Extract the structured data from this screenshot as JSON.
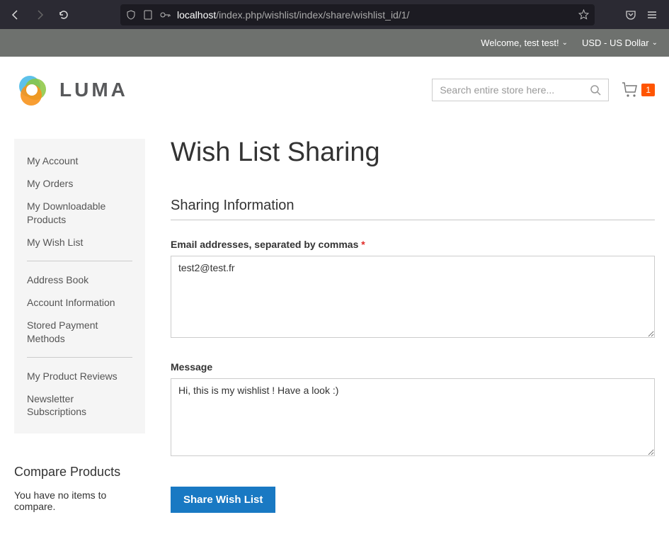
{
  "browser": {
    "url_host": "localhost",
    "url_path": "/index.php/wishlist/index/share/wishlist_id/1/"
  },
  "panel": {
    "welcome": "Welcome, test test!",
    "currency": "USD - US Dollar"
  },
  "header": {
    "logo_text": "LUMA",
    "search_placeholder": "Search entire store here...",
    "cart_count": "1"
  },
  "sidebar": {
    "nav_group1": [
      "My Account",
      "My Orders",
      "My Downloadable Products",
      "My Wish List"
    ],
    "nav_group2": [
      "Address Book",
      "Account Information",
      "Stored Payment Methods"
    ],
    "nav_group3": [
      "My Product Reviews",
      "Newsletter Subscriptions"
    ],
    "compare_title": "Compare Products",
    "compare_empty": "You have no items to compare."
  },
  "page": {
    "title": "Wish List Sharing",
    "legend": "Sharing Information",
    "emails_label": "Email addresses, separated by commas",
    "emails_value": "test2@test.fr",
    "message_label": "Message",
    "message_value": "Hi, this is my wishlist ! Have a look :)",
    "submit_label": "Share Wish List"
  }
}
